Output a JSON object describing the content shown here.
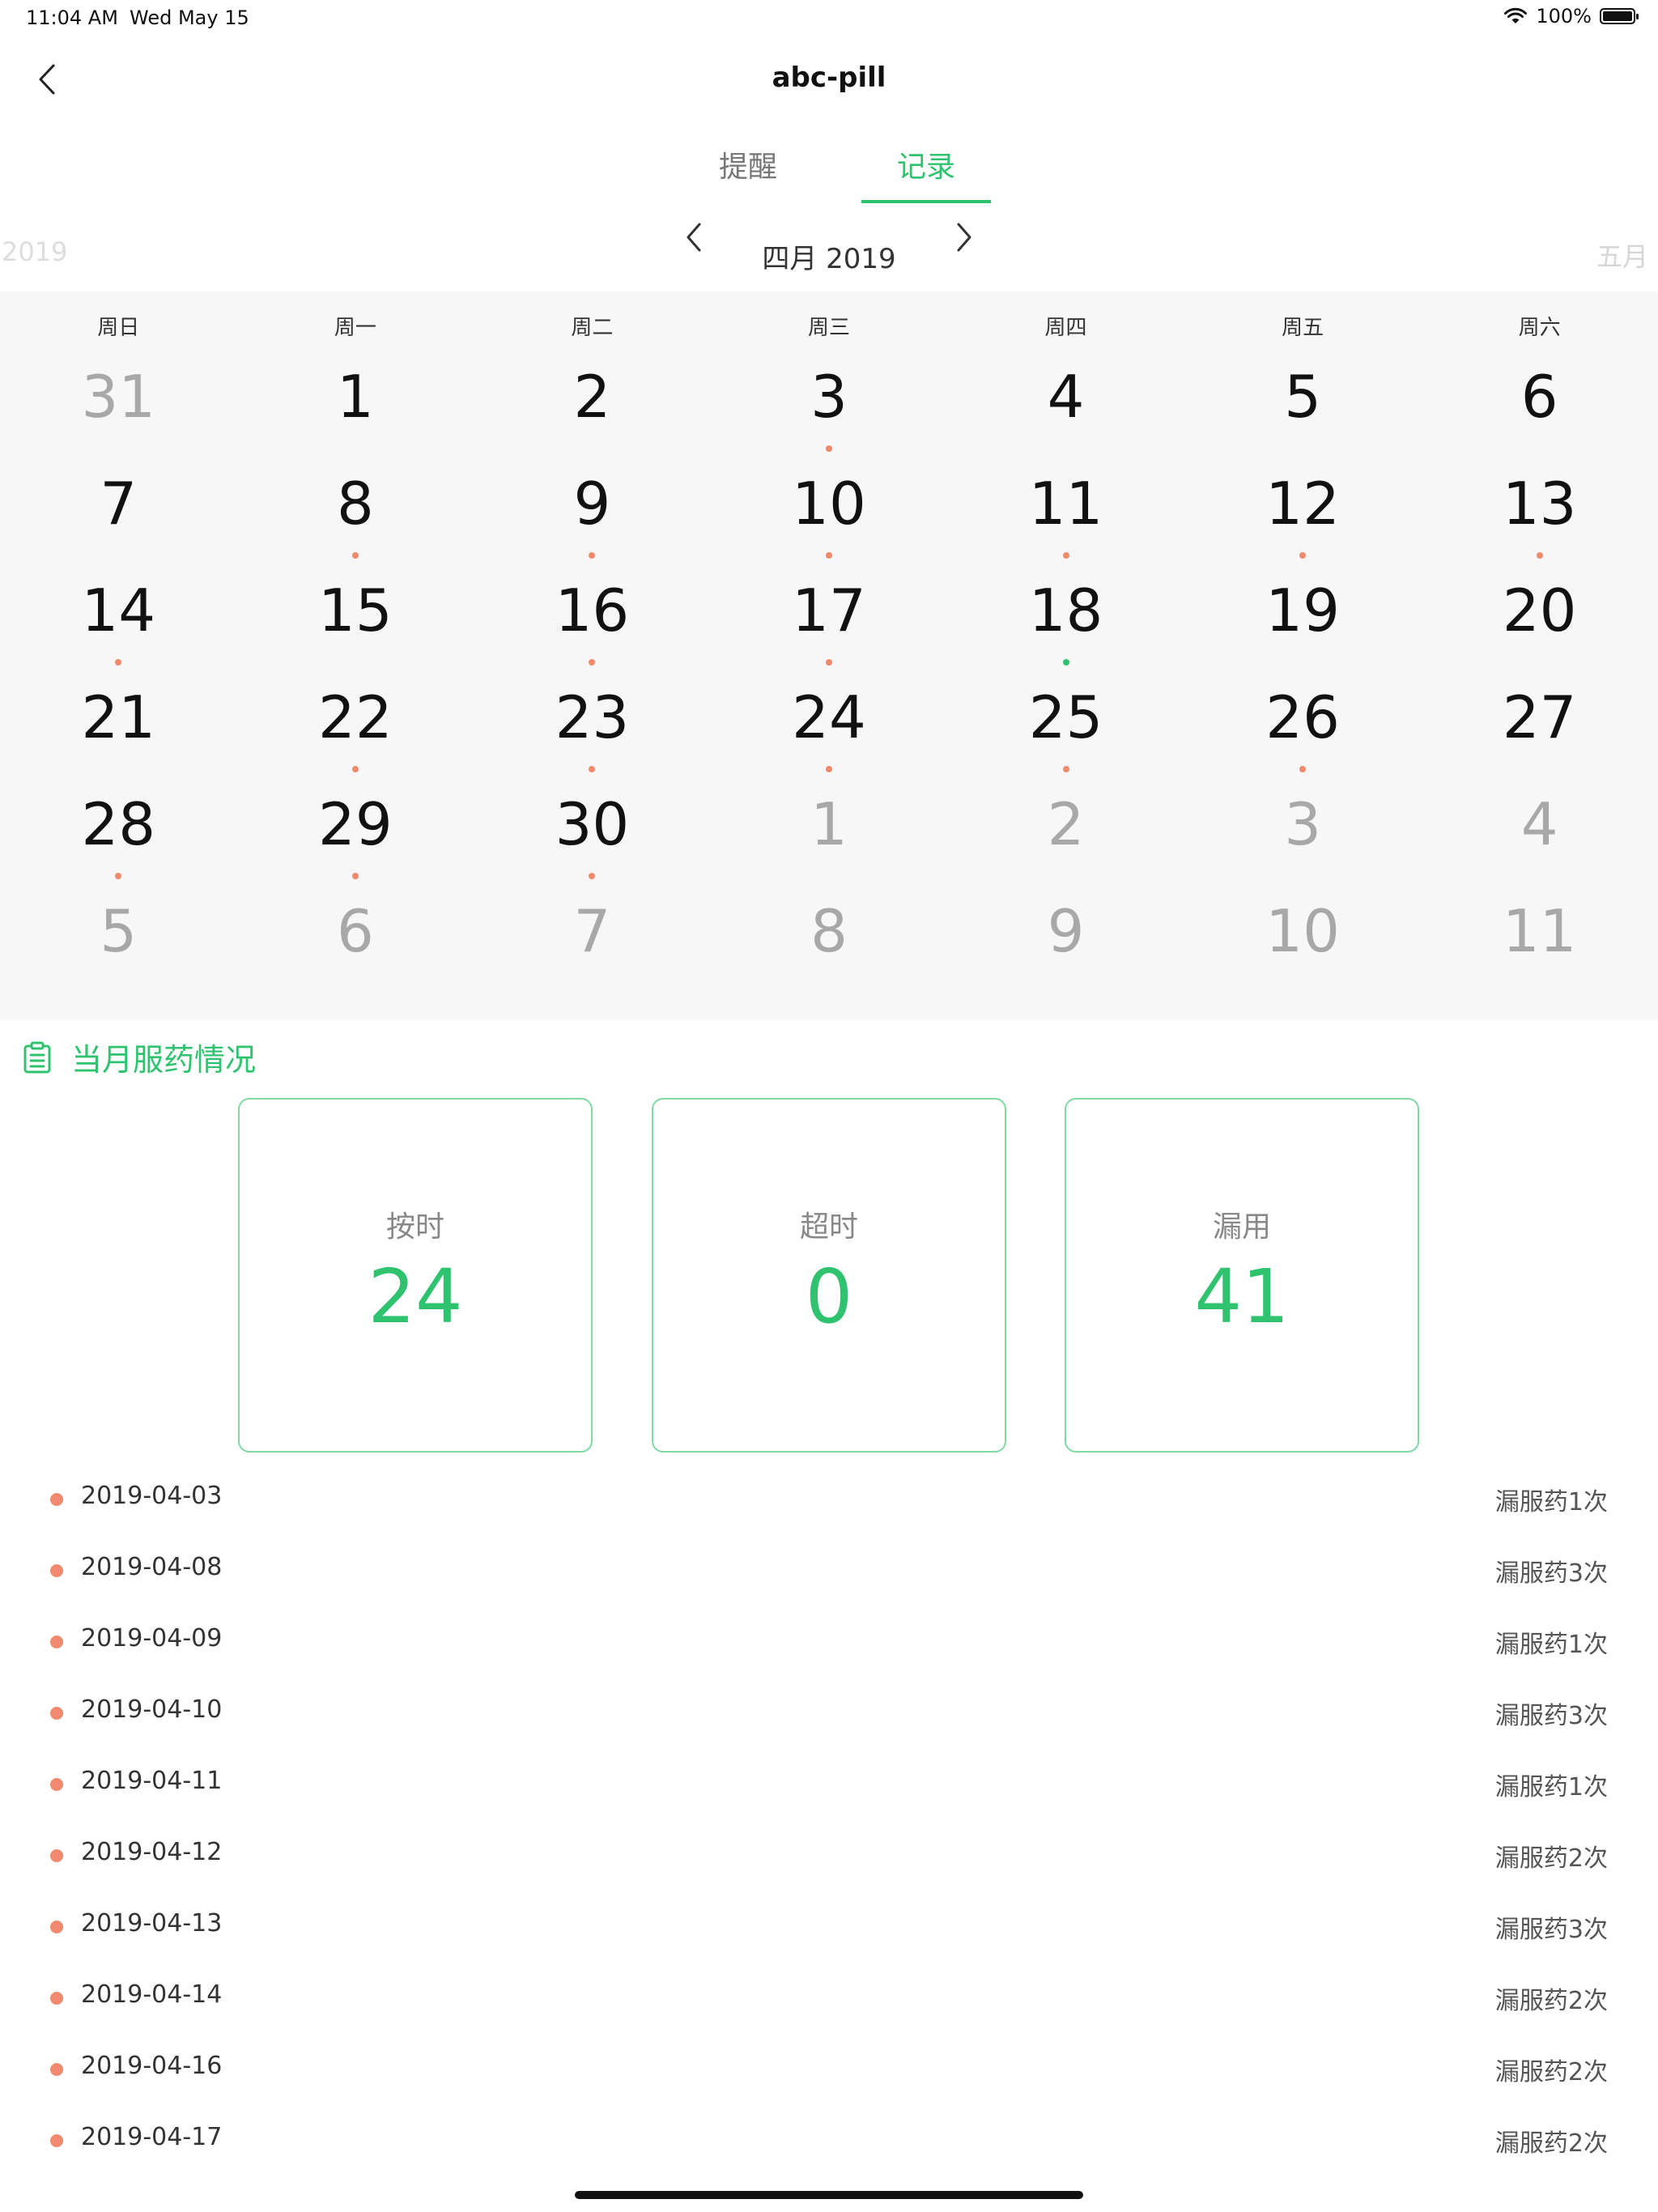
{
  "status_bar": {
    "time": "11:04 AM",
    "date": "Wed May 15",
    "battery_text": "100%",
    "battery_level": 1.0
  },
  "nav": {
    "title": "abc-pill",
    "back_icon": "chevron-left-icon"
  },
  "tabs": [
    {
      "label": "提醒",
      "active": false
    },
    {
      "label": "记录",
      "active": true
    }
  ],
  "month_header": {
    "prev_year_text": "2019",
    "current_label": "四月 2019",
    "next_month_text": "五月"
  },
  "calendar": {
    "weekdays": [
      "周日",
      "周一",
      "周二",
      "周三",
      "周四",
      "周五",
      "周六"
    ],
    "days": [
      {
        "day": "31",
        "current": false,
        "status": "none"
      },
      {
        "day": "1",
        "current": true,
        "status": "none"
      },
      {
        "day": "2",
        "current": true,
        "status": "none"
      },
      {
        "day": "3",
        "current": true,
        "status": "missed"
      },
      {
        "day": "4",
        "current": true,
        "status": "none"
      },
      {
        "day": "5",
        "current": true,
        "status": "none"
      },
      {
        "day": "6",
        "current": true,
        "status": "none"
      },
      {
        "day": "7",
        "current": true,
        "status": "none"
      },
      {
        "day": "8",
        "current": true,
        "status": "missed"
      },
      {
        "day": "9",
        "current": true,
        "status": "missed"
      },
      {
        "day": "10",
        "current": true,
        "status": "missed"
      },
      {
        "day": "11",
        "current": true,
        "status": "missed"
      },
      {
        "day": "12",
        "current": true,
        "status": "missed"
      },
      {
        "day": "13",
        "current": true,
        "status": "missed"
      },
      {
        "day": "14",
        "current": true,
        "status": "missed"
      },
      {
        "day": "15",
        "current": true,
        "status": "none"
      },
      {
        "day": "16",
        "current": true,
        "status": "missed"
      },
      {
        "day": "17",
        "current": true,
        "status": "missed"
      },
      {
        "day": "18",
        "current": true,
        "status": "ontime"
      },
      {
        "day": "19",
        "current": true,
        "status": "none"
      },
      {
        "day": "20",
        "current": true,
        "status": "none"
      },
      {
        "day": "21",
        "current": true,
        "status": "none"
      },
      {
        "day": "22",
        "current": true,
        "status": "missed"
      },
      {
        "day": "23",
        "current": true,
        "status": "missed"
      },
      {
        "day": "24",
        "current": true,
        "status": "missed"
      },
      {
        "day": "25",
        "current": true,
        "status": "missed"
      },
      {
        "day": "26",
        "current": true,
        "status": "missed"
      },
      {
        "day": "27",
        "current": true,
        "status": "none"
      },
      {
        "day": "28",
        "current": true,
        "status": "missed"
      },
      {
        "day": "29",
        "current": true,
        "status": "missed"
      },
      {
        "day": "30",
        "current": true,
        "status": "missed"
      },
      {
        "day": "1",
        "current": false,
        "status": "none"
      },
      {
        "day": "2",
        "current": false,
        "status": "none"
      },
      {
        "day": "3",
        "current": false,
        "status": "none"
      },
      {
        "day": "4",
        "current": false,
        "status": "none"
      },
      {
        "day": "5",
        "current": false,
        "status": "none"
      },
      {
        "day": "6",
        "current": false,
        "status": "none"
      },
      {
        "day": "7",
        "current": false,
        "status": "none"
      },
      {
        "day": "8",
        "current": false,
        "status": "none"
      },
      {
        "day": "9",
        "current": false,
        "status": "none"
      },
      {
        "day": "10",
        "current": false,
        "status": "none"
      },
      {
        "day": "11",
        "current": false,
        "status": "none"
      }
    ]
  },
  "summary": {
    "title": "当月服药情况",
    "icon": "clipboard-icon",
    "cards": [
      {
        "label": "按时",
        "value": "24"
      },
      {
        "label": "超时",
        "value": "0"
      },
      {
        "label": "漏用",
        "value": "41"
      }
    ]
  },
  "missed_list": [
    {
      "date": "2019-04-03",
      "count_text": "漏服药1次"
    },
    {
      "date": "2019-04-08",
      "count_text": "漏服药3次"
    },
    {
      "date": "2019-04-09",
      "count_text": "漏服药1次"
    },
    {
      "date": "2019-04-10",
      "count_text": "漏服药3次"
    },
    {
      "date": "2019-04-11",
      "count_text": "漏服药1次"
    },
    {
      "date": "2019-04-12",
      "count_text": "漏服药2次"
    },
    {
      "date": "2019-04-13",
      "count_text": "漏服药3次"
    },
    {
      "date": "2019-04-14",
      "count_text": "漏服药2次"
    },
    {
      "date": "2019-04-16",
      "count_text": "漏服药2次"
    },
    {
      "date": "2019-04-17",
      "count_text": "漏服药2次"
    }
  ],
  "colors": {
    "accent": "#2fc36f",
    "missed_dot": "#f08a6e",
    "calendar_bg": "#f7f7f7",
    "card_border": "#7fd9a4"
  }
}
